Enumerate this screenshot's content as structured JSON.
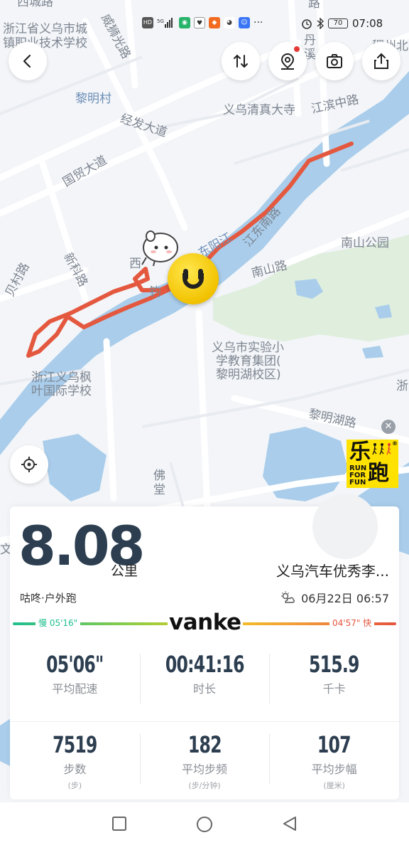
{
  "status_bar": {
    "time": "07:08",
    "battery": "70",
    "left_icons": [
      "hd-icon",
      "5g-signal-icon",
      "app-icon-green",
      "app-icon-heart",
      "app-icon-orange",
      "wechat-icon",
      "app-icon-blue",
      "more-dots-icon"
    ],
    "right_icons": [
      "alarm-icon",
      "bluetooth-icon"
    ]
  },
  "map": {
    "labels": [
      {
        "text": "西城路",
        "name": "map-label-xicheng-road"
      },
      {
        "text": "浙江省义乌市城",
        "name": "map-label-school-1a"
      },
      {
        "text": "镇职业技术学校",
        "name": "map-label-school-1b"
      },
      {
        "text": "威狮光路",
        "name": "map-label-weishiguang-road"
      },
      {
        "text": "黎明村",
        "name": "map-label-liming-village"
      },
      {
        "text": "经发大道",
        "name": "map-label-jingfa-avenue"
      },
      {
        "text": "义乌清真大寺",
        "name": "map-label-mosque"
      },
      {
        "text": "江滨中路",
        "name": "map-label-jiangbin-road"
      },
      {
        "text": "国贸大道",
        "name": "map-label-guomao-avenue"
      },
      {
        "text": "江东南路",
        "name": "map-label-jiangdong-south-road"
      },
      {
        "text": "南山公园",
        "name": "map-label-nanshan-park"
      },
      {
        "text": "东阳江",
        "name": "map-label-dongyang-river"
      },
      {
        "text": "新科路",
        "name": "map-label-xinke-road"
      },
      {
        "text": "贝村路",
        "name": "map-label-beicun-road"
      },
      {
        "text": "南山路",
        "name": "map-label-nanshan-road"
      },
      {
        "text": "义乌市实验小",
        "name": "map-label-primary-school-a"
      },
      {
        "text": "学教育集团(",
        "name": "map-label-primary-school-b"
      },
      {
        "text": "黎明湖校区)",
        "name": "map-label-primary-school-c"
      },
      {
        "text": "浙江义乌枫",
        "name": "map-label-intl-school-a"
      },
      {
        "text": "叶国际学校",
        "name": "map-label-intl-school-b"
      },
      {
        "text": "黎明湖路",
        "name": "map-label-liminghu-road"
      },
      {
        "text": "佛堂",
        "name": "map-label-fotang"
      },
      {
        "text": "丹溪",
        "name": "map-label-danxi"
      },
      {
        "text": "稠州北",
        "name": "map-label-chouzhou"
      },
      {
        "text": "路",
        "name": "map-label-road-top"
      },
      {
        "text": "浙",
        "name": "map-label-zhe-edge"
      },
      {
        "text": "文",
        "name": "map-label-wen-edge"
      },
      {
        "text": "西",
        "name": "map-label-xi-mid"
      },
      {
        "text": "钓",
        "name": "map-label-diao-mid"
      }
    ]
  },
  "brand_logo": {
    "char_1": "乐",
    "char_2": "跑",
    "run": "RUN",
    "for": "FOR",
    "fun": "FUN",
    "registered": "®"
  },
  "close_glyph": "✕",
  "summary": {
    "distance": "8.08",
    "distance_unit": "公里",
    "route_name": "义乌汽车优秀李...",
    "sport_type": "咕咚·户外跑",
    "date": "06月22日 06:57",
    "pace_slow": "慢 05'16\"",
    "pace_fast": "04'57\" 快",
    "sponsor": "vanke"
  },
  "stats_row_1": [
    {
      "value": "05'06\"",
      "label": "平均配速",
      "name": "stat-avg-pace"
    },
    {
      "value": "00:41:16",
      "label": "时长",
      "name": "stat-duration"
    },
    {
      "value": "515.9",
      "label": "千卡",
      "name": "stat-calories"
    }
  ],
  "stats_row_2": [
    {
      "value": "7519",
      "label": "步数",
      "unit": "(步)",
      "name": "stat-steps"
    },
    {
      "value": "182",
      "label": "平均步频",
      "unit": "(步/分钟)",
      "name": "stat-cadence"
    },
    {
      "value": "107",
      "label": "平均步幅",
      "unit": "(厘米)",
      "name": "stat-stride"
    }
  ],
  "colors": {
    "route": "#e4583f",
    "river": "#a9cdeb",
    "park": "#dff0df",
    "pace_slow": "#1fbf8f",
    "pace_fast": "#e4553e",
    "brand_yellow": "#ffe200",
    "value_text": "#2c3e50"
  }
}
